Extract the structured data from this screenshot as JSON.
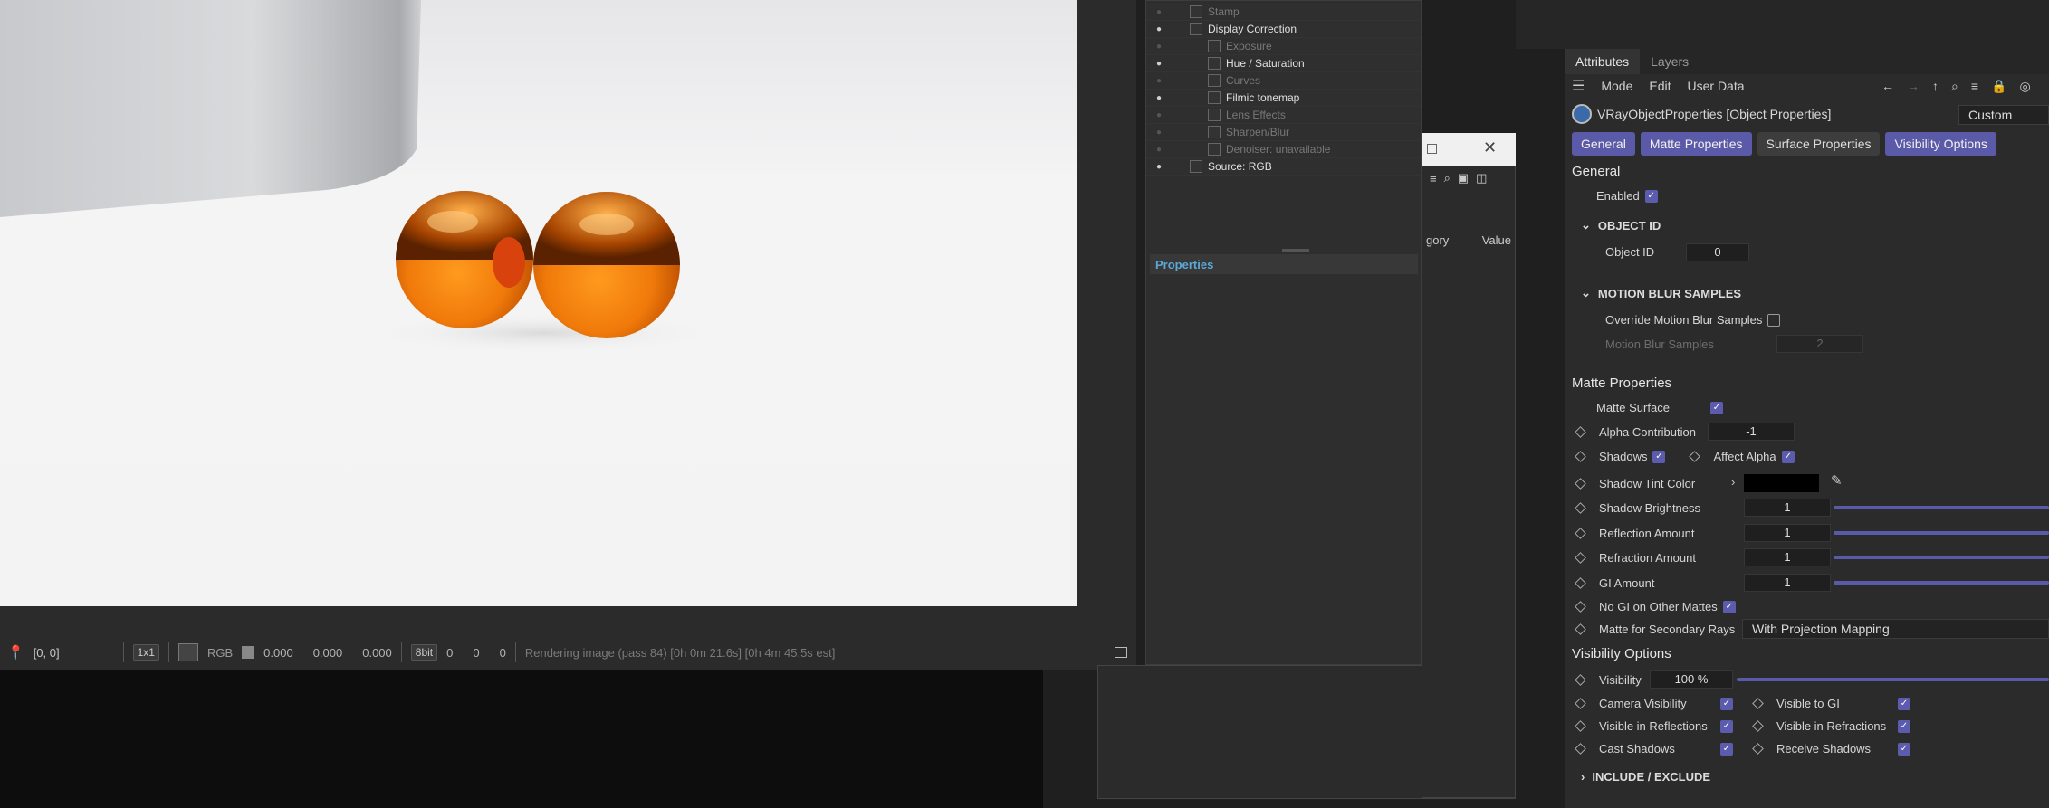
{
  "render": {
    "coords": "[0, 0]",
    "region": "1x1",
    "channel": "RGB",
    "vals": [
      "0.000",
      "0.000",
      "0.000"
    ],
    "bit": "8bit",
    "ivals": [
      "0",
      "0",
      "0"
    ],
    "status": "Rendering image (pass 84) [0h  0m 21.6s] [0h  4m 45.5s est]"
  },
  "layers": [
    {
      "label": "Stamp",
      "on": false
    },
    {
      "label": "Display Correction",
      "on": true
    },
    {
      "label": "Exposure",
      "on": false
    },
    {
      "label": "Hue / Saturation",
      "on": true
    },
    {
      "label": "Curves",
      "on": false
    },
    {
      "label": "Filmic tonemap",
      "on": true
    },
    {
      "label": "Lens Effects",
      "on": false
    },
    {
      "label": "Sharpen/Blur",
      "on": false
    },
    {
      "label": "Denoiser: unavailable",
      "on": false
    },
    {
      "label": "Source: RGB",
      "on": true
    }
  ],
  "properties_label": "Properties",
  "dialog_cols": [
    "gory",
    "Value"
  ],
  "attr": {
    "tabs": [
      "Attributes",
      "Layers"
    ],
    "menu": [
      "Mode",
      "Edit",
      "User Data"
    ],
    "object": "VRayObjectProperties [Object Properties]",
    "preset": "Custom",
    "ptabs": [
      "General",
      "Matte Properties",
      "Surface Properties",
      "Visibility Options"
    ],
    "general": "General",
    "enabled": "Enabled",
    "object_id_group": "OBJECT ID",
    "object_id_label": "Object ID",
    "object_id_value": "0",
    "mb_group": "MOTION BLUR SAMPLES",
    "mb_override": "Override Motion Blur Samples",
    "mb_samples": "Motion Blur Samples",
    "mb_value": "2",
    "matte_section": "Matte Properties",
    "matte_surface": "Matte Surface",
    "alpha_contrib": "Alpha Contribution",
    "alpha_value": "-1",
    "shadows": "Shadows",
    "affect_alpha": "Affect Alpha",
    "shadow_tint": "Shadow Tint Color",
    "shadow_brightness": "Shadow Brightness",
    "reflection_amount": "Reflection Amount",
    "refraction_amount": "Refraction Amount",
    "gi_amount": "GI Amount",
    "one": "1",
    "no_gi": "No GI on Other Mattes",
    "matte_secondary": "Matte for Secondary Rays",
    "matte_secondary_value": "With Projection Mapping",
    "vis_section": "Visibility Options",
    "visibility": "Visibility",
    "visibility_value": "100 %",
    "camera_vis": "Camera Visibility",
    "visible_gi": "Visible to GI",
    "visible_refl": "Visible in Reflections",
    "visible_refr": "Visible in Refractions",
    "cast_shadows": "Cast Shadows",
    "receive_shadows": "Receive Shadows",
    "include_exclude": "INCLUDE / EXCLUDE"
  }
}
